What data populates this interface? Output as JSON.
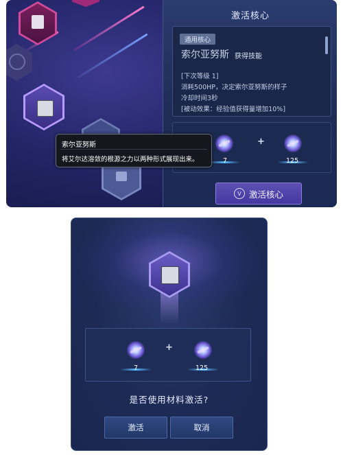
{
  "core_panel": {
    "title": "激活核心",
    "tag": "通用核心",
    "skill_name": "索尔亚努斯",
    "skill_suffix": "获得技能",
    "lines": [
      "[下次等级 1]",
      "消耗500HP，决定索尔亚努斯的样子",
      "冷却时间3秒",
      "[被动效果：经验值获得量增加10%]"
    ],
    "materials": [
      {
        "icon": "purple-crystal-icon",
        "count": "7"
      },
      {
        "icon": "blue-crystal-icon",
        "count": "125"
      }
    ],
    "plus": "+",
    "activate_button": "激活核心",
    "activate_icon": "V"
  },
  "tooltip": {
    "title": "索尔亚努斯",
    "description": "将艾尔达溶敛的根源之力以两种形式展现出来。"
  },
  "dialog": {
    "materials": [
      {
        "icon": "purple-crystal-icon",
        "count": "7"
      },
      {
        "icon": "blue-crystal-icon",
        "count": "125"
      }
    ],
    "plus": "+",
    "question": "是否使用材料激活?",
    "confirm_button": "激活",
    "cancel_button": "取消"
  },
  "colors": {
    "accent_purple": "#5e4fb3",
    "node_magenta": "#b0307a",
    "panel_blue": "#1e2c56"
  }
}
